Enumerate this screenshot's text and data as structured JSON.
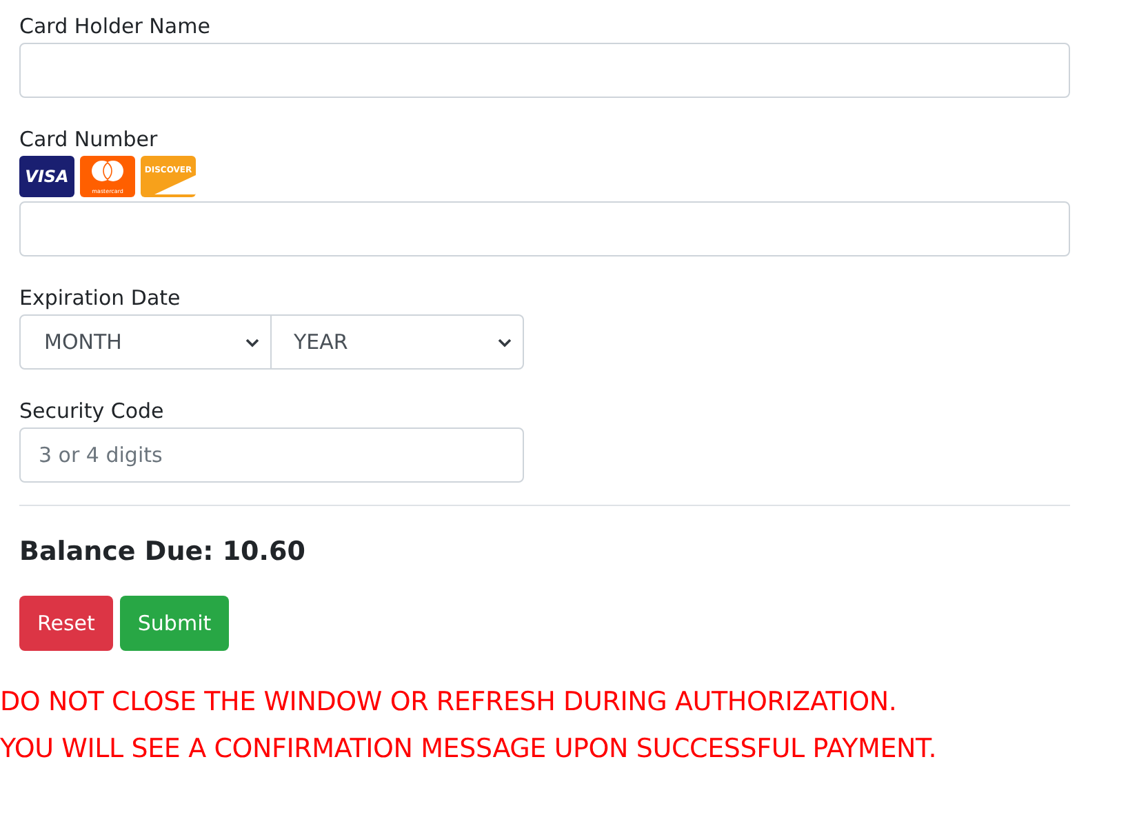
{
  "card_holder": {
    "label": "Card Holder Name"
  },
  "card_number": {
    "label": "Card Number",
    "logos": [
      {
        "kind": "visa",
        "text": "VISA"
      },
      {
        "kind": "mastercard",
        "text": "mastercard"
      },
      {
        "kind": "discover",
        "text": "DISCOVER"
      }
    ]
  },
  "expiration": {
    "label": "Expiration Date",
    "month": "MONTH",
    "year": "YEAR"
  },
  "security_code": {
    "label": "Security Code",
    "placeholder": "3 or 4 digits"
  },
  "balance": "Balance Due: 10.60",
  "buttons": [
    {
      "kind": "reset",
      "label": "Reset"
    },
    {
      "kind": "submit",
      "label": "Submit"
    }
  ],
  "warnings": [
    "DO NOT CLOSE THE WINDOW OR REFRESH DURING AUTHORIZATION.",
    "YOU WILL SEE A CONFIRMATION MESSAGE UPON SUCCESSFUL PAYMENT."
  ]
}
